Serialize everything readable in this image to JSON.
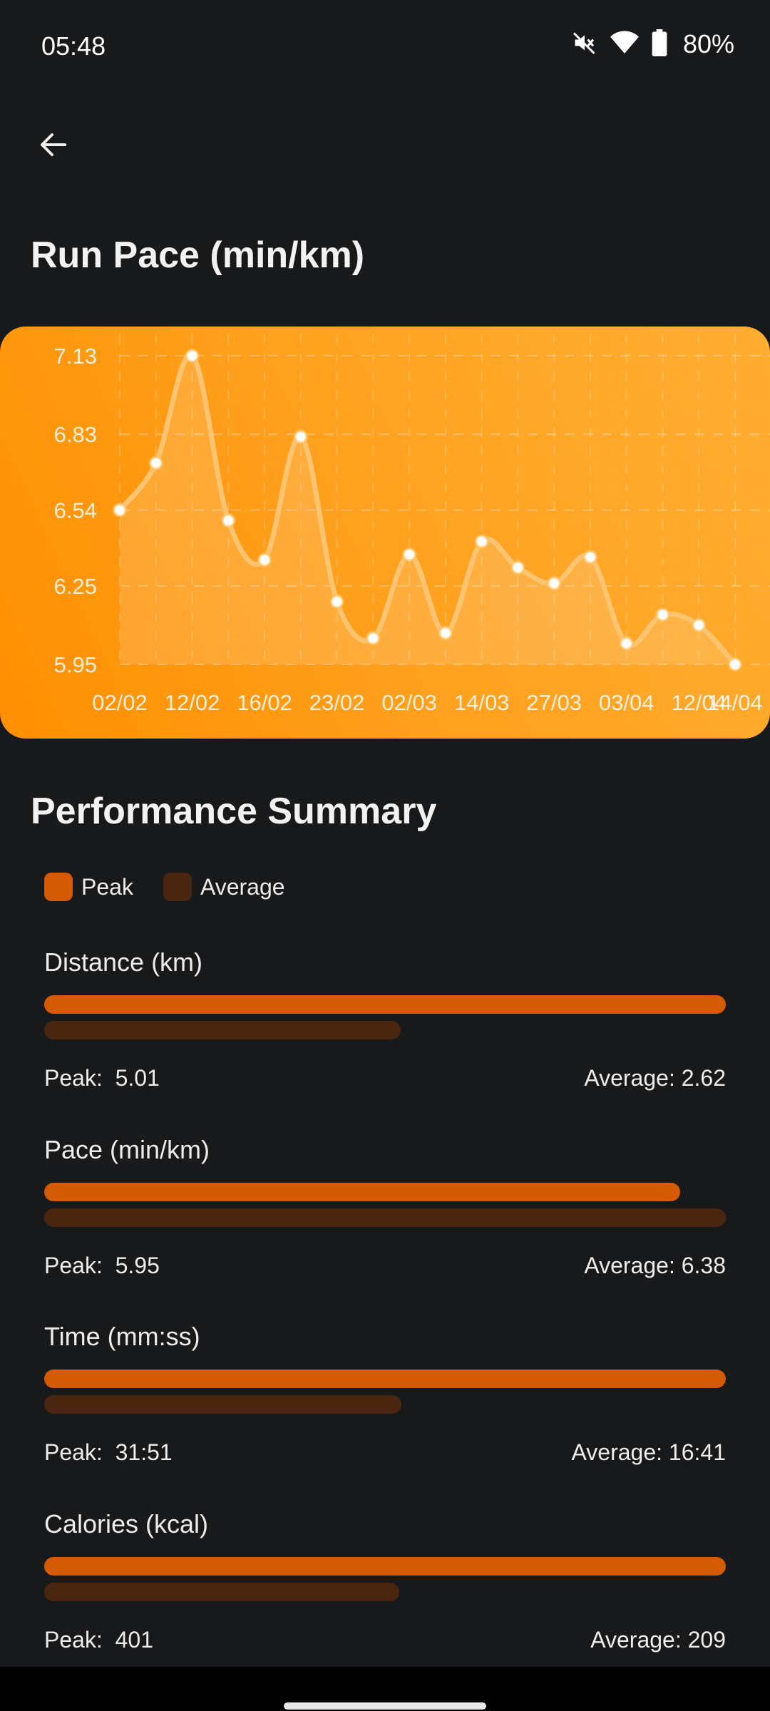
{
  "status_bar": {
    "time": "05:48",
    "battery": "80%",
    "icons": [
      "mute-icon",
      "wifi-icon",
      "battery-icon"
    ]
  },
  "header": {
    "back_icon": "back-arrow-icon"
  },
  "title": "Run Pace (min/km)",
  "chart_data": {
    "type": "line",
    "x": [
      "02/02",
      "07/02",
      "12/02",
      "14/02",
      "16/02",
      "19/02",
      "23/02",
      "26/02",
      "02/03",
      "07/03",
      "14/03",
      "20/03",
      "27/03",
      "30/03",
      "03/04",
      "08/04",
      "12/04",
      "14/04"
    ],
    "x_tick_labels": [
      "02/02",
      "12/02",
      "16/02",
      "23/02",
      "02/03",
      "14/03",
      "27/03",
      "03/04",
      "12/04",
      "14/04"
    ],
    "y": [
      6.54,
      6.72,
      7.13,
      6.5,
      6.35,
      6.82,
      6.19,
      6.05,
      6.37,
      6.07,
      6.42,
      6.32,
      6.26,
      6.36,
      6.03,
      6.14,
      6.1,
      5.95
    ],
    "y_ticks": [
      "7.13",
      "6.83",
      "6.54",
      "6.25",
      "5.95"
    ],
    "ylim": [
      5.95,
      7.13
    ],
    "grid": true,
    "colors": {
      "background": "#ff9800",
      "line": "#ffc470",
      "point": "#ffffff"
    }
  },
  "summary": {
    "title": "Performance Summary",
    "legend": [
      {
        "label": "Peak",
        "color": "#d55a06"
      },
      {
        "label": "Average",
        "color": "#4a2611"
      }
    ],
    "peak_prefix": "Peak:",
    "average_prefix": "Average:",
    "metrics": [
      {
        "title": "Distance (km)",
        "peak": "5.01",
        "average": "2.62",
        "peak_fraction": 1.0,
        "average_fraction": 0.523
      },
      {
        "title": "Pace (min/km)",
        "peak": "5.95",
        "average": "6.38",
        "peak_fraction": 0.933,
        "average_fraction": 1.0
      },
      {
        "title": "Time (mm:ss)",
        "peak": "31:51",
        "average": "16:41",
        "peak_fraction": 1.0,
        "average_fraction": 0.524
      },
      {
        "title": "Calories (kcal)",
        "peak": "401",
        "average": "209",
        "peak_fraction": 1.0,
        "average_fraction": 0.521
      }
    ]
  }
}
